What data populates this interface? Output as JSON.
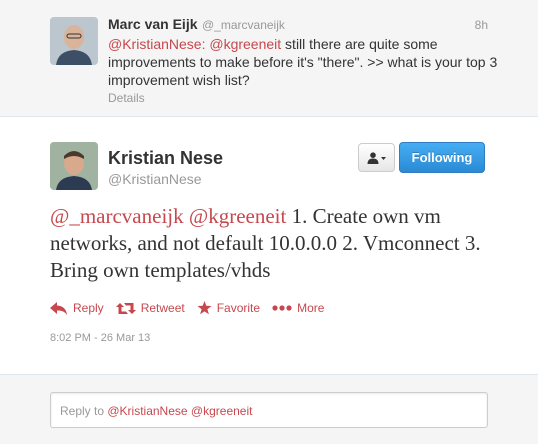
{
  "parent_tweet": {
    "name": "Marc van Eijk",
    "handle": "@_marcvaneijk",
    "time": "8h",
    "mention1": "@KristianNese:",
    "mention2": "@kgreeneit",
    "text": " still there are quite some improvements to make before it's \"there\". >> what is your top 3 improvement wish list?",
    "details_label": "Details"
  },
  "main_tweet": {
    "name": "Kristian Nese",
    "handle": "@KristianNese",
    "follow_label": "Following",
    "mention1": "@_marcvaneijk",
    "mention2": "@kgreeneit",
    "text": " 1. Create own vm networks, and not default 10.0.0.0 2. Vmconnect 3. Bring own templates/vhds",
    "actions": {
      "reply": "Reply",
      "retweet": "Retweet",
      "favorite": "Favorite",
      "more": "More"
    },
    "timestamp": "8:02 PM - 26 Mar 13"
  },
  "reply_box": {
    "prefix": "Reply to ",
    "mention1": "@KristianNese",
    "mention2": "@kgreeneit"
  },
  "colors": {
    "link": "#c6484e",
    "follow_button": "#2a8ad4"
  }
}
